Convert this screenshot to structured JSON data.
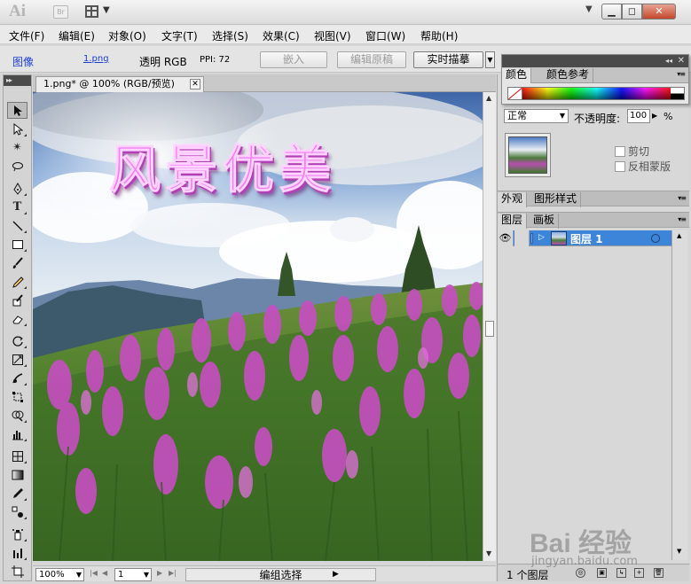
{
  "window": {
    "logo": "Ai",
    "bridge_label": "Br",
    "minimize": "▁",
    "restore": "◻",
    "close": "✕"
  },
  "menu": [
    "文件(F)",
    "编辑(E)",
    "对象(O)",
    "文字(T)",
    "选择(S)",
    "效果(C)",
    "视图(V)",
    "窗口(W)",
    "帮助(H)"
  ],
  "control_bar": {
    "object_type": "图像",
    "file_link": "1.png",
    "mode": "透明 RGB",
    "ppi": "PPI: 72",
    "embed": "嵌入",
    "edit_original": "编辑原稿",
    "live_trace": "实时描摹"
  },
  "document": {
    "tab_title": "1.png* @ 100% (RGB/预览)",
    "artwork_text": "风景优美"
  },
  "status_bar": {
    "zoom": "100%",
    "page": "1",
    "status": "编组选择"
  },
  "color_panel": {
    "tabs": [
      "颜色",
      "颜色参考"
    ]
  },
  "transparency": {
    "blend_mode": "正常",
    "opacity_label": "不透明度:",
    "opacity_value": "100",
    "percent": "%",
    "clip": "剪切",
    "invert_mask": "反相蒙版"
  },
  "appearance_panel": {
    "tabs": [
      "外观",
      "图形样式"
    ]
  },
  "layers_panel": {
    "tabs": [
      "图层",
      "画板"
    ],
    "layer_name": "图层 1",
    "count": "1 个图层"
  },
  "watermark": {
    "main": "Bai 经验",
    "sub": "jingyan.baidu.com"
  },
  "colors": {
    "layer_selected": "#3d85d8",
    "title_pink": "#f27cf0",
    "close_red": "#c4472c"
  }
}
